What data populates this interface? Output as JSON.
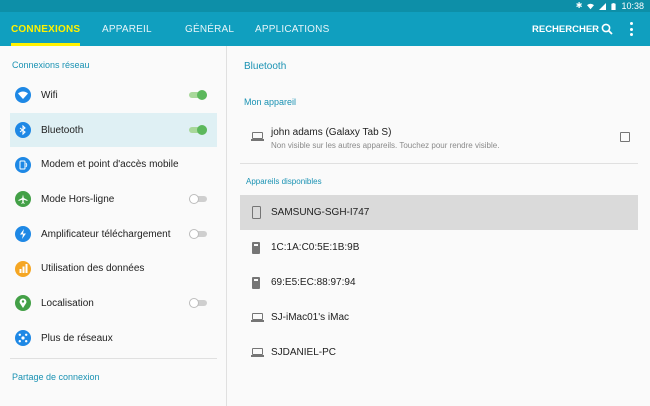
{
  "status_bar": {
    "time": "10:38",
    "icons": [
      "bluetooth-icon",
      "wifi-icon",
      "signal-icon",
      "battery-icon"
    ]
  },
  "tabs": [
    {
      "label": "CONNEXIONS",
      "active": true
    },
    {
      "label": "APPAREIL",
      "active": false
    },
    {
      "label": "GÉNÉRAL",
      "active": false
    },
    {
      "label": "APPLICATIONS",
      "active": false
    }
  ],
  "header": {
    "search_label": "RECHERCHER"
  },
  "sidebar": {
    "section1": "Connexions réseau",
    "items": [
      {
        "label": "Wifi",
        "icon": "wifi-icon",
        "color": "#1e88e5",
        "toggle": "on",
        "selected": false
      },
      {
        "label": "Bluetooth",
        "icon": "bluetooth-icon",
        "color": "#1e88e5",
        "toggle": "on",
        "selected": true
      },
      {
        "label": "Modem et point d'accès mobile",
        "icon": "hotspot-icon",
        "color": "#1e88e5",
        "toggle": null,
        "selected": false
      },
      {
        "label": "Mode Hors-ligne",
        "icon": "airplane-icon",
        "color": "#43a047",
        "toggle": "off",
        "selected": false
      },
      {
        "label": "Amplificateur téléchargement",
        "icon": "download-booster-icon",
        "color": "#1e88e5",
        "toggle": "off",
        "selected": false
      },
      {
        "label": "Utilisation des données",
        "icon": "data-usage-icon",
        "color": "#f5a623",
        "toggle": null,
        "selected": false
      },
      {
        "label": "Localisation",
        "icon": "location-icon",
        "color": "#43a047",
        "toggle": "off",
        "selected": false
      },
      {
        "label": "Plus de réseaux",
        "icon": "more-networks-icon",
        "color": "#1e88e5",
        "toggle": null,
        "selected": false
      }
    ],
    "section2": "Partage de connexion"
  },
  "main": {
    "title": "Bluetooth",
    "my_device_header": "Mon appareil",
    "my_device": {
      "name": "john adams (Galaxy Tab S)",
      "subtitle": "Non visible sur les autres appareils. Touchez pour rendre visible."
    },
    "available_header": "Appareils disponibles",
    "available": [
      {
        "name": "SAMSUNG-SGH-I747",
        "icon": "phone-icon",
        "selected": true
      },
      {
        "name": "1C:1A:C0:5E:1B:9B",
        "icon": "device-icon",
        "selected": false
      },
      {
        "name": "69:E5:EC:88:97:94",
        "icon": "device-icon",
        "selected": false
      },
      {
        "name": "SJ-iMac01's iMac",
        "icon": "laptop-icon",
        "selected": false
      },
      {
        "name": "SJDANIEL-PC",
        "icon": "laptop-icon",
        "selected": false
      }
    ]
  }
}
